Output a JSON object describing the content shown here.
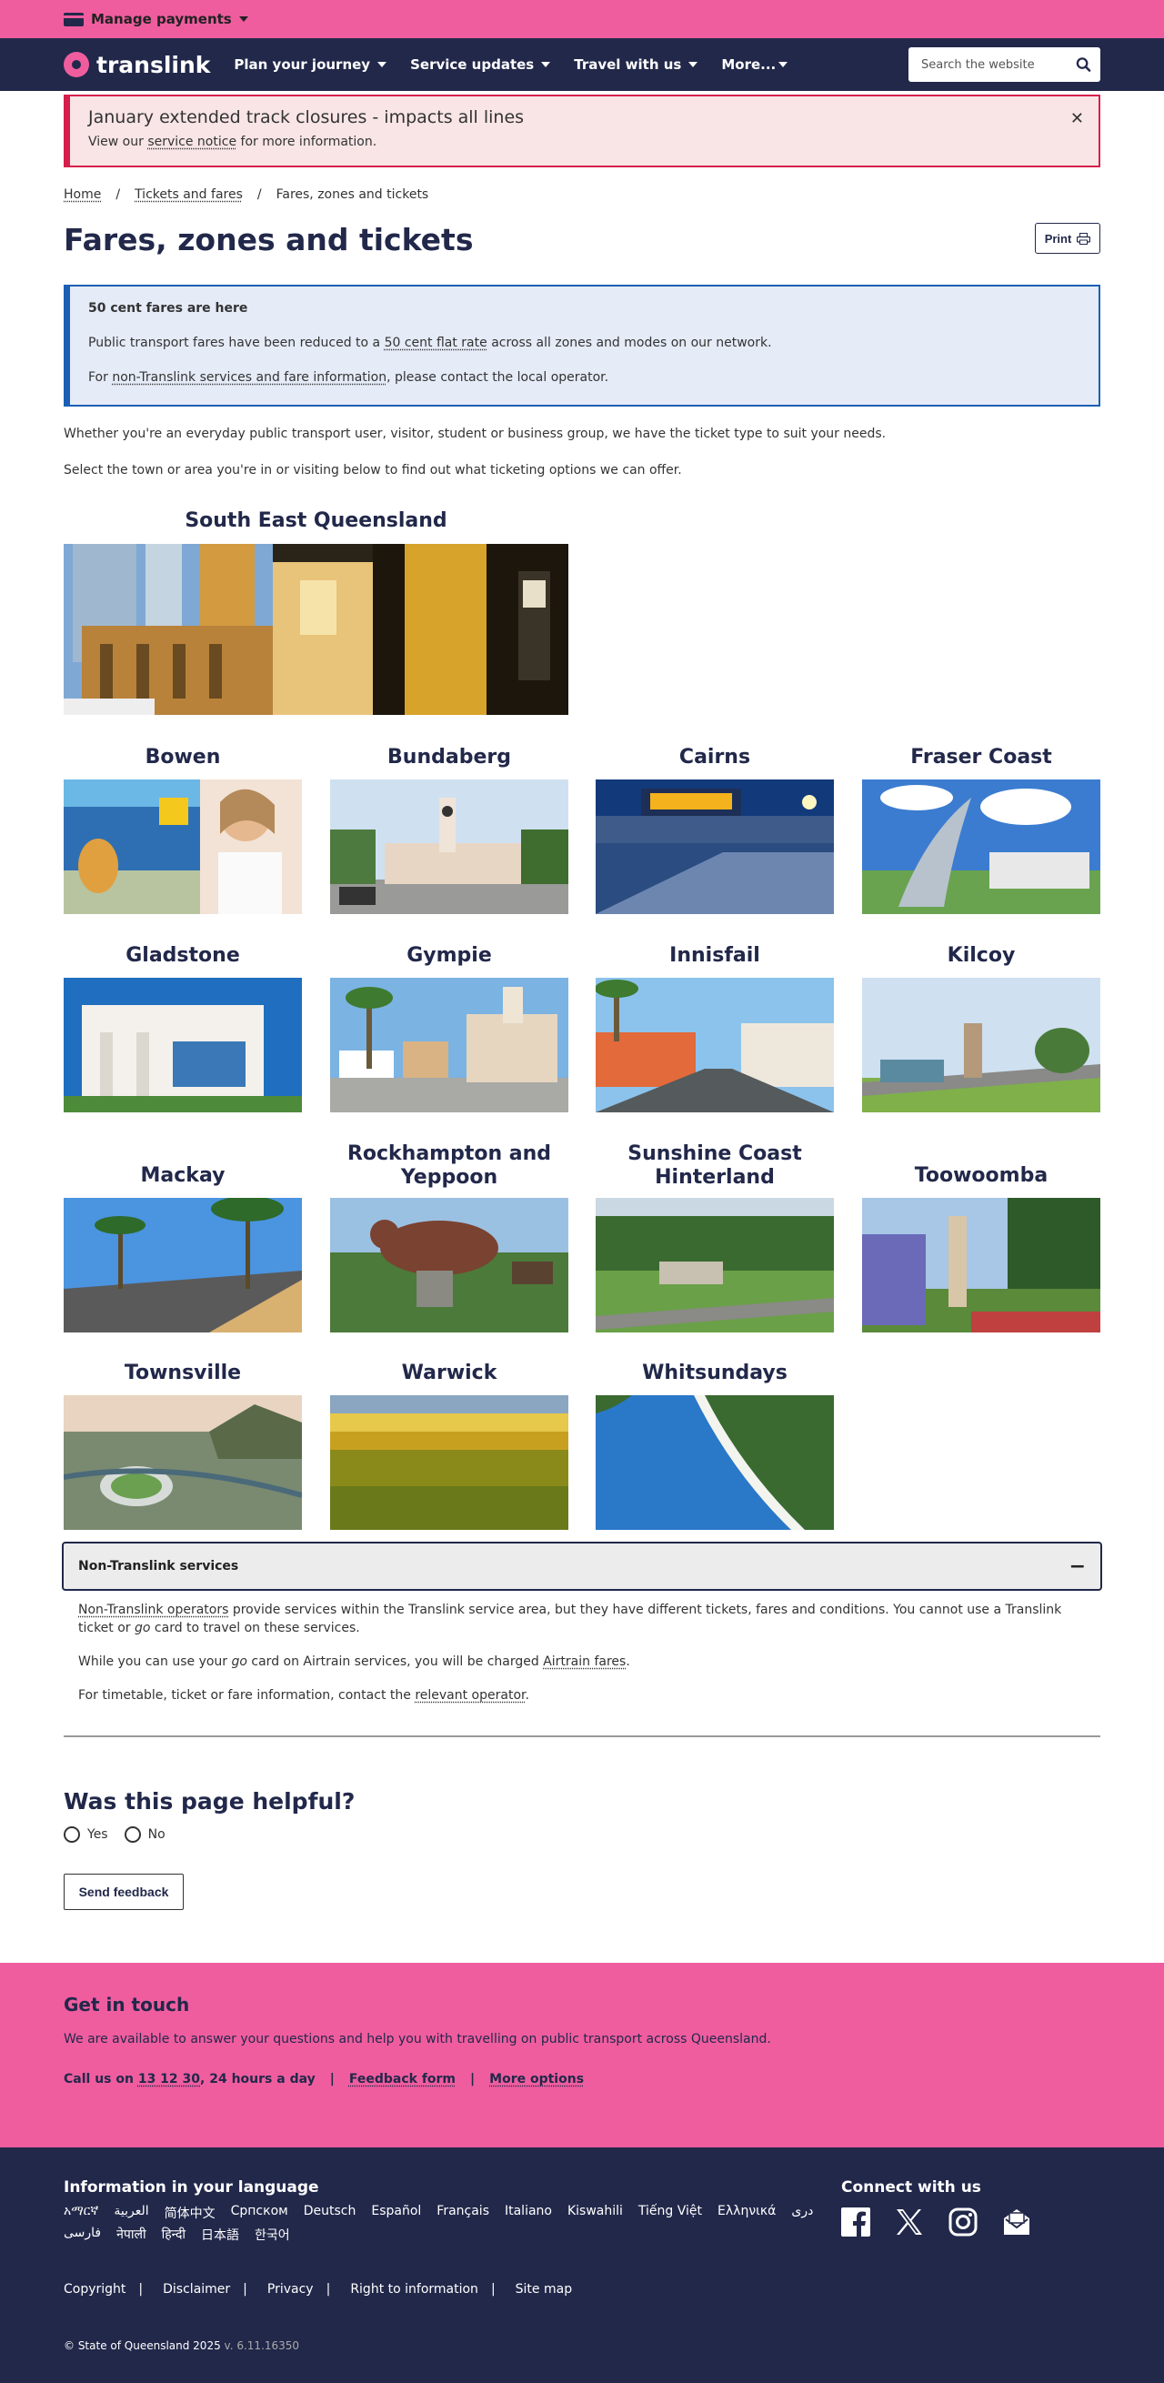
{
  "topbar": {
    "manage_payments": "Manage payments"
  },
  "nav": {
    "brand": "translink",
    "items": [
      "Plan your journey",
      "Service updates",
      "Travel with us",
      "More..."
    ],
    "search_placeholder": "Search the website"
  },
  "alert": {
    "title": "January extended track closures - impacts all lines",
    "prefix": "View our",
    "link": "service notice",
    "suffix": "for more information."
  },
  "breadcrumb": [
    "Home",
    "Tickets and fares",
    "Fares, zones and tickets"
  ],
  "page_title": "Fares, zones and tickets",
  "print_label": "Print",
  "info": {
    "heading": "50 cent fares are here",
    "p1_prefix": "Public transport fares have been reduced to a",
    "p1_link": "50 cent flat rate",
    "p1_suffix": "across all zones and modes on our network.",
    "p2_prefix": "For",
    "p2_link": "non-Translink services and fare information",
    "p2_suffix": ", please contact the local operator."
  },
  "intro1": "Whether you're an everyday public transport user, visitor, student or business group, we have the ticket type to suit your needs.",
  "intro2": "Select the town or area you're in or visiting below to find out what ticketing options we can offer.",
  "regions": {
    "seq": "South East Queensland",
    "list": [
      "Bowen",
      "Bundaberg",
      "Cairns",
      "Fraser Coast",
      "Gladstone",
      "Gympie",
      "Innisfail",
      "Kilcoy",
      "Mackay",
      "Rockhampton and Yeppoon",
      "Sunshine Coast Hinterland",
      "Toowoomba",
      "Townsville",
      "Warwick",
      "Whitsundays"
    ]
  },
  "accordion": {
    "title": "Non-Translink services",
    "toggle": "−",
    "p1_link": "Non-Translink operators",
    "p1_a": "provide services within the Translink service area, but they have different tickets, fares and conditions. You cannot use a Translink ticket or",
    "p1_go": "go",
    "p1_b": "card to travel on these services.",
    "p2_a": "While you can use your",
    "p2_go": "go",
    "p2_b": "card on Airtrain services, you will be charged",
    "p2_link": "Airtrain fares",
    "p2_c": ".",
    "p3_a": "For timetable, ticket or fare information, contact the",
    "p3_link": "relevant operator",
    "p3_b": "."
  },
  "feedback": {
    "question": "Was this page helpful?",
    "yes": "Yes",
    "no": "No",
    "send": "Send feedback"
  },
  "contact": {
    "title": "Get in touch",
    "desc": "We are available to answer your questions and help you with travelling on public transport across Queensland.",
    "call_prefix": "Call us on",
    "phone": "13 12 30",
    "call_suffix": ", 24 hours a day",
    "sep": "|",
    "feedback_form": "Feedback form",
    "more_options": "More options"
  },
  "footer": {
    "lang_title": "Information in your language",
    "languages": [
      "አማርኛ",
      "العربية",
      "简体中文",
      "Српском",
      "Deutsch",
      "Español",
      "Français",
      "Italiano",
      "Kiswahili",
      "Tiếng Việt",
      "Ελληνικά",
      "دری",
      "فارسی",
      "नेपाली",
      "हिन्दी",
      "日本語",
      "한국어"
    ],
    "connect_title": "Connect with us",
    "social": [
      "facebook-icon",
      "x-icon",
      "instagram-icon",
      "email-icon"
    ],
    "links": [
      "Copyright",
      "Disclaimer",
      "Privacy",
      "Right to information",
      "Site map"
    ],
    "copyright": "© State of Queensland 2025",
    "version": "v. 6.11.16350"
  },
  "colors": {
    "pink": "#ef5d9f",
    "navy": "#22284a",
    "alert_red": "#d6204b",
    "info_blue": "#1a5fb4"
  }
}
